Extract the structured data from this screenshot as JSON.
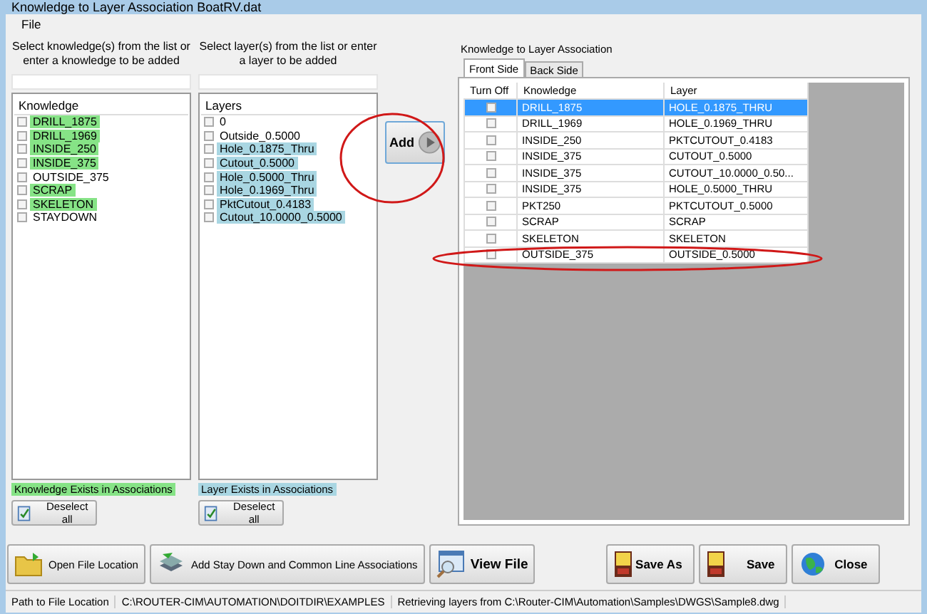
{
  "window": {
    "title": "Knowledge to Layer Association BoatRV.dat"
  },
  "menu": [
    {
      "label": "File"
    }
  ],
  "knowledge_panel": {
    "caption": "Select knowledge(s) from the list or enter a knowledge to be added",
    "header": "Knowledge",
    "items": [
      {
        "label": "DRILL_1875",
        "checked": false,
        "exists": true
      },
      {
        "label": "DRILL_1969",
        "checked": false,
        "exists": true
      },
      {
        "label": "INSIDE_250",
        "checked": false,
        "exists": true
      },
      {
        "label": "INSIDE_375",
        "checked": false,
        "exists": true
      },
      {
        "label": "OUTSIDE_375",
        "checked": false,
        "exists": false
      },
      {
        "label": "SCRAP",
        "checked": false,
        "exists": true
      },
      {
        "label": "SKELETON",
        "checked": false,
        "exists": true
      },
      {
        "label": "STAYDOWN",
        "checked": false,
        "exists": false
      }
    ],
    "legend": "Knowledge Exists in Associations",
    "button": "Deselect all"
  },
  "layer_panel": {
    "caption": "Select layer(s) from the list or enter a layer to be added",
    "header": "Layers",
    "items": [
      {
        "label": "0",
        "checked": false,
        "exists": false
      },
      {
        "label": "Outside_0.5000",
        "checked": false,
        "exists": false
      },
      {
        "label": "Hole_0.1875_Thru",
        "checked": false,
        "exists": true
      },
      {
        "label": "Cutout_0.5000",
        "checked": false,
        "exists": true
      },
      {
        "label": "Hole_0.5000_Thru",
        "checked": false,
        "exists": true
      },
      {
        "label": "Hole_0.1969_Thru",
        "checked": false,
        "exists": true
      },
      {
        "label": "PktCutout_0.4183",
        "checked": false,
        "exists": true
      },
      {
        "label": "Cutout_10.0000_0.5000",
        "checked": false,
        "exists": true
      }
    ],
    "legend": "Layer Exists in Associations",
    "button": "Deselect all"
  },
  "add_button": "Add",
  "association": {
    "title": "Knowledge to Layer Association",
    "tabs": [
      {
        "label": "Front Side",
        "selected": true
      },
      {
        "label": "Back Side",
        "selected": false
      }
    ],
    "columns": [
      "Turn Off",
      "Knowledge",
      "Layer"
    ],
    "rows": [
      {
        "knowledge": "DRILL_1875",
        "layer": "HOLE_0.1875_THRU",
        "turn_off": false,
        "selected": true
      },
      {
        "knowledge": "DRILL_1969",
        "layer": "HOLE_0.1969_THRU",
        "turn_off": false,
        "selected": false
      },
      {
        "knowledge": "INSIDE_250",
        "layer": "PKTCUTOUT_0.4183",
        "turn_off": false,
        "selected": false
      },
      {
        "knowledge": "INSIDE_375",
        "layer": "CUTOUT_0.5000",
        "turn_off": false,
        "selected": false
      },
      {
        "knowledge": "INSIDE_375",
        "layer": "CUTOUT_10.0000_0.50...",
        "turn_off": false,
        "selected": false
      },
      {
        "knowledge": "INSIDE_375",
        "layer": "HOLE_0.5000_THRU",
        "turn_off": false,
        "selected": false
      },
      {
        "knowledge": "PKT250",
        "layer": "PKTCUTOUT_0.5000",
        "turn_off": false,
        "selected": false
      },
      {
        "knowledge": "SCRAP",
        "layer": "SCRAP",
        "turn_off": false,
        "selected": false
      },
      {
        "knowledge": "SKELETON",
        "layer": "SKELETON",
        "turn_off": false,
        "selected": false
      },
      {
        "knowledge": "OUTSIDE_375",
        "layer": "OUTSIDE_0.5000",
        "turn_off": false,
        "selected": false
      }
    ]
  },
  "toolbar": [
    {
      "label": "Open File Location",
      "kind": "folder",
      "bold": false
    },
    {
      "label": "Add Stay Down and Common Line Associations",
      "kind": "stack",
      "bold": false
    },
    {
      "label": "View File",
      "kind": "view",
      "bold": true
    }
  ],
  "actions": [
    {
      "label": "Save As",
      "kind": "disk"
    },
    {
      "label": "Save",
      "kind": "disk"
    },
    {
      "label": "Close",
      "kind": "globe"
    }
  ],
  "status_bar": [
    {
      "text": "Path to File Location"
    },
    {
      "text": "C:\\ROUTER-CIM\\AUTOMATION\\DOITDIR\\EXAMPLES"
    },
    {
      "text": "Retrieving layers from C:\\Router-CIM\\Automation\\Samples\\DWGS\\Sample8.dwg"
    }
  ]
}
